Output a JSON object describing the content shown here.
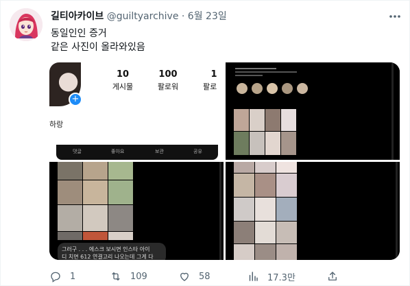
{
  "tweet": {
    "display_name": "길티아카이브",
    "handle": "@guiltyarchive",
    "separator": "·",
    "date": "6월 23일",
    "text_line1": "동일인인 증거",
    "text_line2": "같은 사진이 올라와있음"
  },
  "media": {
    "profile": {
      "posts_count": "10",
      "posts_label": "게시물",
      "followers_count": "100",
      "followers_label": "팔로워",
      "following_count": "1",
      "following_label": "팔로",
      "bio_fragment": "하랑",
      "action_comment": "댓글",
      "action_like": "좋아요",
      "action_save": "보관",
      "action_share": "공유"
    },
    "caption": {
      "line1": "그러구 . . . 에스크 보시면 인스타 아이",
      "line2": "디 치면 612 연결고리 나오는데 그게 다"
    }
  },
  "actions": {
    "replies": "1",
    "retweets": "109",
    "likes": "58",
    "views": "17.3만"
  }
}
